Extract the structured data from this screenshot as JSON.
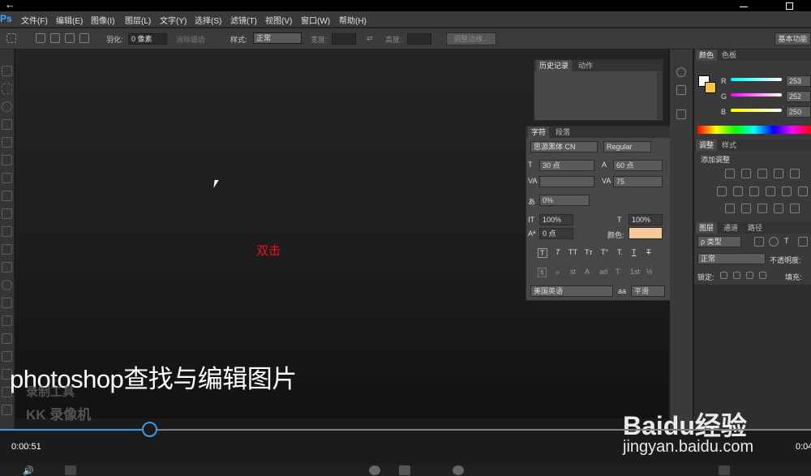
{
  "window": {
    "back_icon": "back-arrow-icon",
    "minimize_icon": "minimize-icon",
    "maximize_icon": "maximize-icon"
  },
  "menu": {
    "app_icon": "Ps",
    "items": [
      "文件(F)",
      "编辑(E)",
      "图像(I)",
      "图层(L)",
      "文字(Y)",
      "选择(S)",
      "滤镜(T)",
      "视图(V)",
      "窗口(W)",
      "帮助(H)"
    ]
  },
  "options": {
    "feather_label": "羽化:",
    "feather_value": "0 像素",
    "antialias_label": "消除锯齿",
    "style_label": "样式:",
    "style_value": "正常",
    "width_label": "宽度:",
    "height_label": "高度:",
    "refine_button": "调整边缘...",
    "workspace_button": "基本功能"
  },
  "canvas": {
    "annotation": "双击",
    "subtitle": "photoshop查找与编辑图片"
  },
  "history_panel": {
    "tabs": [
      "历史记录",
      "动作"
    ]
  },
  "char_panel": {
    "tabs": [
      "字符",
      "段落"
    ],
    "font_family": "思源黑体 CN",
    "font_style": "Regular",
    "font_size": "30 点",
    "leading": "60 点",
    "tracking": "75",
    "kerning_scale": "0%",
    "vertical_scale": "100%",
    "horizontal_scale": "100%",
    "baseline": "0 点",
    "color_label": "颜色:",
    "color_value": "#f7c99a",
    "language": "美国英语",
    "aa_label": "aa",
    "antialias": "平滑"
  },
  "color_panel": {
    "tabs": [
      "颜色",
      "色板"
    ],
    "r_label": "R",
    "r": "253",
    "g_label": "G",
    "g": "252",
    "b_label": "B",
    "b": "250"
  },
  "adjust_panel": {
    "tabs": [
      "调整",
      "样式"
    ],
    "title": "添加调整"
  },
  "layers_panel": {
    "tabs": [
      "图层",
      "通道",
      "路径"
    ],
    "filter": "ρ 类型",
    "blend": "正常",
    "opacity_label": "不透明度:",
    "lock_label": "锁定:",
    "fill_label": "填充:"
  },
  "player": {
    "progress": 0.184,
    "current_time": "0:00:51",
    "end_time": "0:04"
  },
  "watermark": {
    "line1": "录制工具",
    "line2": "KK 录像机",
    "baidu": "Baidu经验",
    "url": "jingyan.baidu.com"
  }
}
